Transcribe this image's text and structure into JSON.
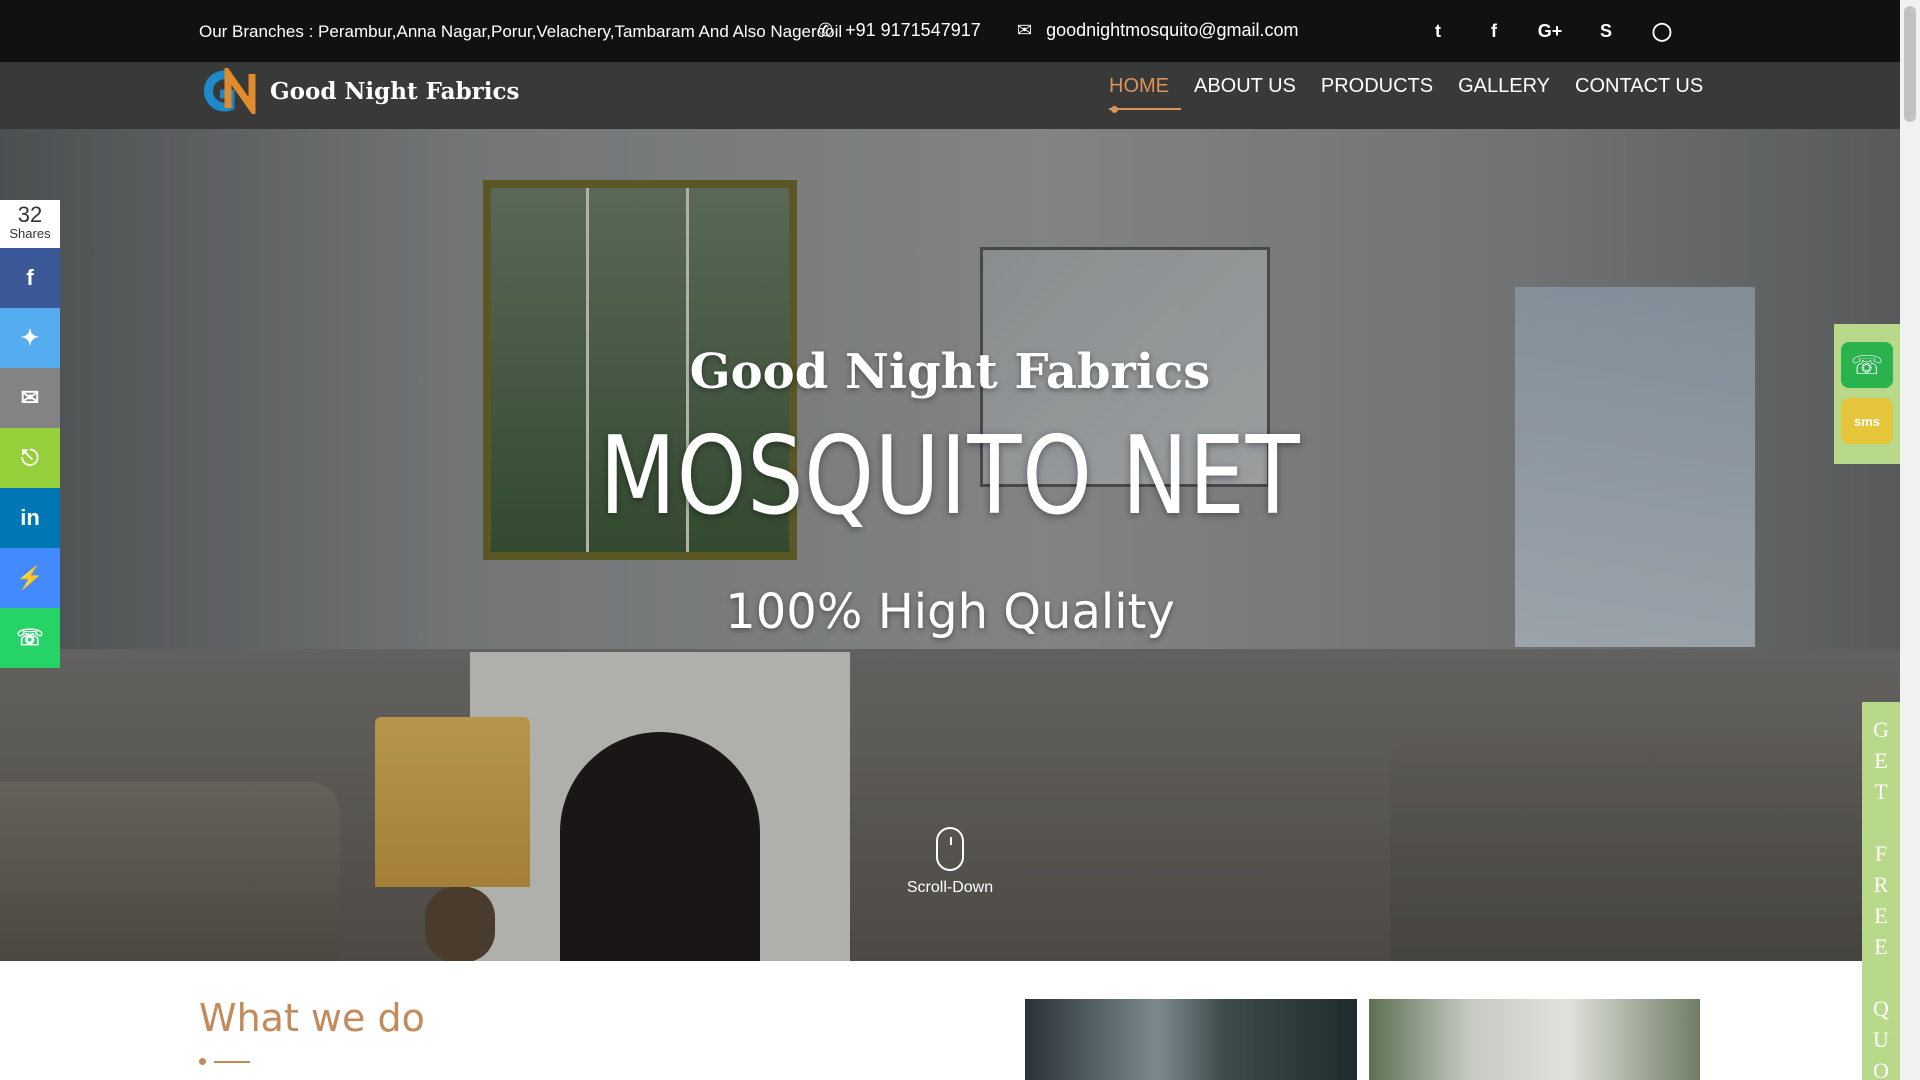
{
  "topbar": {
    "branches": "Our Branches : Perambur,Anna Nagar,Porur,Velachery,Tambaram And Also Nagercoil",
    "phone": "+91 9171547917",
    "email": "goodnightmosquito@gmail.com",
    "social_icons": [
      "twitter-icon",
      "facebook-icon",
      "google-plus-icon",
      "skype-icon",
      "instagram-icon"
    ]
  },
  "logo": {
    "brand": "Good Night Fabrics"
  },
  "nav": {
    "items": [
      {
        "label": "HOME",
        "active": true
      },
      {
        "label": "ABOUT US"
      },
      {
        "label": "PRODUCTS"
      },
      {
        "label": "GALLERY"
      },
      {
        "label": "CONTACT US"
      }
    ]
  },
  "hero": {
    "brand": "Good Night Fabrics",
    "title": "MOSQUITO NET",
    "subtitle": "100% High Quality",
    "scroll_label": "Scroll-Down"
  },
  "share": {
    "count": "32",
    "count_label": "Shares",
    "buttons": [
      {
        "icon": "facebook-icon",
        "color": "#3b5998"
      },
      {
        "icon": "twitter-icon",
        "color": "#55acee"
      },
      {
        "icon": "email-icon",
        "color": "#848484"
      },
      {
        "icon": "share-icon",
        "color": "#95d03a"
      },
      {
        "icon": "linkedin-icon",
        "color": "#0077b5"
      },
      {
        "icon": "messenger-icon",
        "color": "#448aff"
      },
      {
        "icon": "whatsapp-icon",
        "color": "#25d366"
      }
    ]
  },
  "contact_widget": {
    "sms_label": "sms"
  },
  "quote_tab": {
    "letters": [
      "G",
      "E",
      "T",
      "",
      "F",
      "R",
      "E",
      "E",
      "",
      "Q",
      "U",
      "O"
    ]
  },
  "section": {
    "heading": "What we do"
  },
  "colors": {
    "accent": "#d9945a",
    "topbar": "#111111",
    "navbar": "#373737",
    "widget_green": "#b9d98a"
  }
}
